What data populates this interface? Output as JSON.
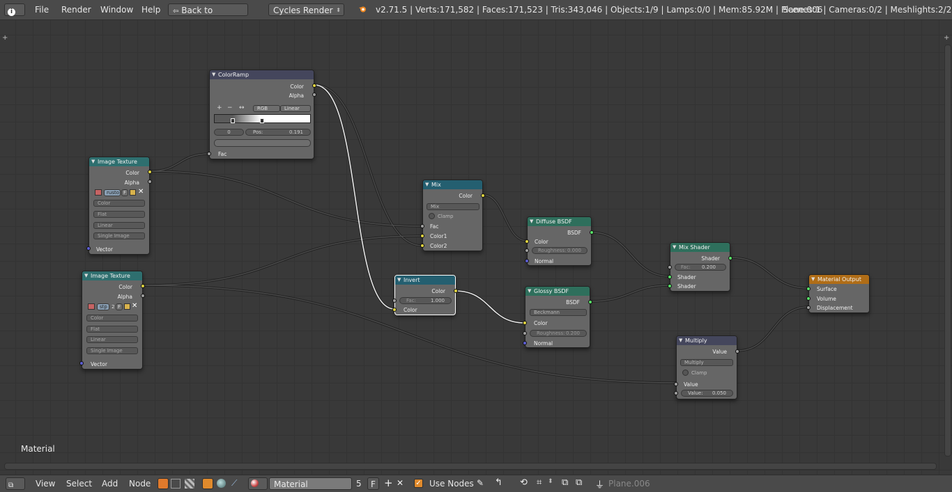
{
  "topbar": {
    "info_icon": "info-icon",
    "menus": [
      "File",
      "Render",
      "Window",
      "Help"
    ],
    "back_label": "Back to Previous",
    "engine": "Cycles Render",
    "stats": "v2.71.5 | Verts:171,582 | Faces:171,523 | Tris:343,046 | Objects:1/9 | Lamps:0/0 | Mem:85.92M | Plane.006",
    "scenes": "Scenes:1 | Cameras:0/2 | Meshlights:2/2"
  },
  "editor": {
    "corner_label": "Material"
  },
  "nodes": {
    "colorramp": {
      "title": "ColorRamp",
      "out_color": "Color",
      "out_alpha": "Alpha",
      "plus": "+",
      "minus": "−",
      "flip": "↔",
      "mode": "RGB",
      "interp": "Linear",
      "index": "0",
      "pos_label": "Pos:",
      "pos_value": "0.191",
      "in_fac": "Fac"
    },
    "imgtex1": {
      "title": "Image Texture",
      "out_color": "Color",
      "out_alpha": "Alpha",
      "image_name": "rusto",
      "image_flag": "F",
      "color_mode": "Color",
      "projection": "Flat",
      "interp": "Linear",
      "source": "Single Image",
      "in_vector": "Vector"
    },
    "imgtex2": {
      "title": "Image Texture",
      "out_color": "Color",
      "out_alpha": "Alpha",
      "image_name": "stp",
      "image_users": "2",
      "image_flag": "F",
      "color_mode": "Color",
      "projection": "Flat",
      "interp": "Linear",
      "source": "Single Image",
      "in_vector": "Vector"
    },
    "mix": {
      "title": "Mix",
      "out_color": "Color",
      "blend": "Mix",
      "clamp": "Clamp",
      "in_fac": "Fac",
      "in_color1": "Color1",
      "in_color2": "Color2"
    },
    "invert": {
      "title": "Invert",
      "out_color": "Color",
      "fac_label": "Fac:",
      "fac_value": "1.000",
      "in_color": "Color"
    },
    "diffuse": {
      "title": "Diffuse BSDF",
      "out_bsdf": "BSDF",
      "in_color": "Color",
      "rough_label": "Roughness:",
      "rough_value": "0.000",
      "in_normal": "Normal"
    },
    "glossy": {
      "title": "Glossy BSDF",
      "out_bsdf": "BSDF",
      "dist": "Beckmann",
      "in_color": "Color",
      "rough_label": "Roughness:",
      "rough_value": "0.200",
      "in_normal": "Normal"
    },
    "mixshader": {
      "title": "Mix Shader",
      "out_shader": "Shader",
      "fac_label": "Fac:",
      "fac_value": "0.200",
      "in_shader1": "Shader",
      "in_shader2": "Shader"
    },
    "multiply": {
      "title": "Multiply",
      "out_value": "Value",
      "op": "Multiply",
      "clamp": "Clamp",
      "in_value": "Value",
      "val_label": "Value:",
      "val_value": "0.050"
    },
    "output": {
      "title": "Material Output",
      "in_surface": "Surface",
      "in_volume": "Volume",
      "in_disp": "Displacement"
    }
  },
  "bottombar": {
    "menus": [
      "View",
      "Select",
      "Add",
      "Node"
    ],
    "material_name": "Material",
    "users": "5",
    "fake_user": "F",
    "use_nodes": "Use Nodes",
    "object_name": "Plane.006"
  },
  "colors": {
    "topbar_bg": "#4a4a4a",
    "editor_bg": "#393939",
    "socket_color": "#e1d540",
    "socket_shader": "#58e067",
    "socket_vector": "#5d5ed4",
    "output_header": "#b06d17"
  }
}
